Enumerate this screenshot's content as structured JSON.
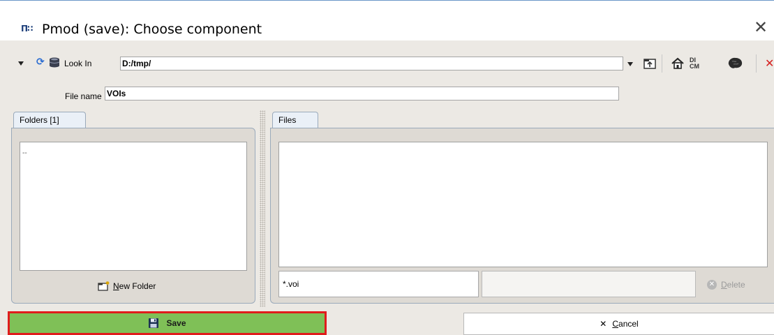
{
  "window": {
    "title": "Pmod (save): Choose component",
    "app_icon": "pmod-logo-icon",
    "app_icon_text": "Π∷"
  },
  "toolbar": {
    "look_in_label": "Look In",
    "look_in_value": "D:/tmp/",
    "icons": [
      "collapse-icon",
      "refresh-icon",
      "database-icon",
      "folder-up-icon",
      "home-icon",
      "dicom-icon",
      "brain-icon",
      "close-icon"
    ],
    "dicom_text": "DI\nCM"
  },
  "file_name": {
    "label": "File name",
    "value": "VOIs"
  },
  "folders": {
    "tab_label": "Folders [1]",
    "items": [
      "--"
    ],
    "new_folder_label_prefix": "",
    "new_folder_mnemonic": "N",
    "new_folder_label_rest": "ew Folder"
  },
  "files": {
    "tab_label": "Files",
    "filter_value": "*.voi",
    "second_filter_value": "",
    "delete_mnemonic": "D",
    "delete_label_rest": "elete"
  },
  "buttons": {
    "save_label": "Save",
    "cancel_symbol": "✕",
    "cancel_mnemonic": "C",
    "cancel_label_rest": "ancel"
  },
  "colors": {
    "save_bg": "#7fc057",
    "highlight_border": "#e01c1c",
    "close_red": "#d62020",
    "accent_blue": "#2b6cd1"
  }
}
